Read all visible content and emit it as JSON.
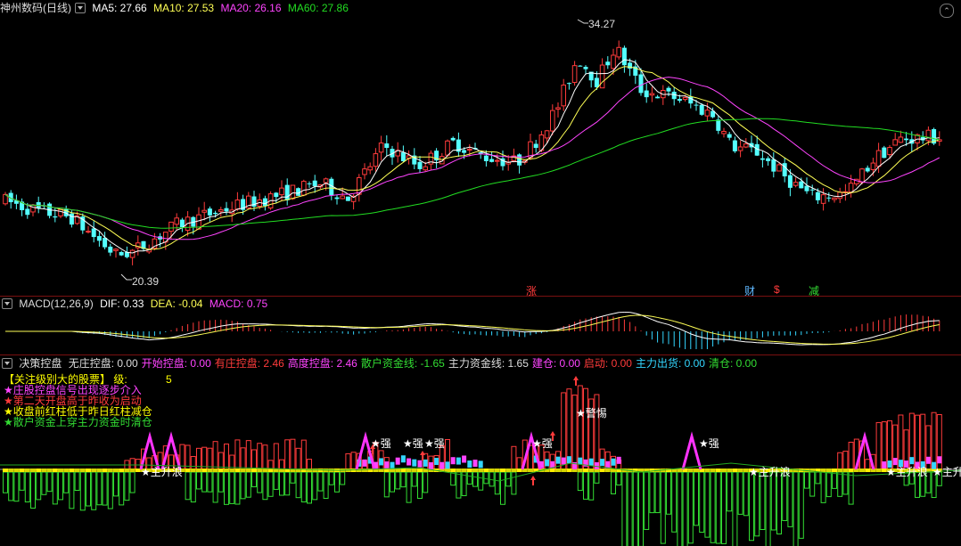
{
  "main_panel": {
    "title": "神州数码(日线)",
    "ma5": "MA5: 27.66",
    "ma10": "MA10: 27.53",
    "ma20": "MA20: 26.16",
    "ma60": "MA60: 27.86",
    "high_label": "34.27",
    "low_label": "20.39",
    "event_marks": [
      "涨",
      "财",
      "$",
      "减"
    ]
  },
  "macd_panel": {
    "title": "MACD(12,26,9)",
    "dif": "DIF: 0.33",
    "dea": "DEA: -0.04",
    "macd": "MACD: 0.75"
  },
  "indicator_panel": {
    "title": "决策控盘",
    "items": [
      {
        "text": "无庄控盘: 0.00",
        "color": "#dddddd"
      },
      {
        "text": "开始控盘: 0.00",
        "color": "#ff44ff"
      },
      {
        "text": "有庄控盘: 2.46",
        "color": "#ff3b3b"
      },
      {
        "text": "高度控盘: 2.46",
        "color": "#ff44ff"
      },
      {
        "text": "散户资金线: -1.65",
        "color": "#33dd33"
      },
      {
        "text": "主力资金线: 1.65",
        "color": "#dddddd"
      },
      {
        "text": "建仓: 0.00",
        "color": "#ff44ff"
      },
      {
        "text": "启动: 0.00",
        "color": "#ff3b3b"
      },
      {
        "text": "主力出货: 0.00",
        "color": "#33d6ff"
      },
      {
        "text": "清仓: 0.00",
        "color": "#33dd33"
      }
    ],
    "legend": [
      {
        "text": "【关注级别大的股票】    级:",
        "value": "5",
        "color": "#ffff00"
      },
      {
        "text": "★庄股控盘信号出现逐步介入",
        "color": "#ff44ff"
      },
      {
        "text": "★第二天开盘高于昨收为启动",
        "color": "#ff3b3b"
      },
      {
        "text": "★收盘前红柱低于昨日红柱减仓",
        "color": "#ffff00"
      },
      {
        "text": "★散户资金上穿主力资金时清仓",
        "color": "#33dd33"
      }
    ],
    "annotations": [
      "★主升浪",
      "★强",
      "★强",
      "★强",
      "★强",
      "★强",
      "★警惕",
      "★主升浪",
      "★主升浪",
      "★主升"
    ]
  },
  "colors": {
    "up": "#ff3b3b",
    "down": "#54ffff",
    "ma5": "#ffffff",
    "ma10": "#ffff55",
    "ma20": "#ff44ff",
    "ma60": "#22dd22"
  }
}
